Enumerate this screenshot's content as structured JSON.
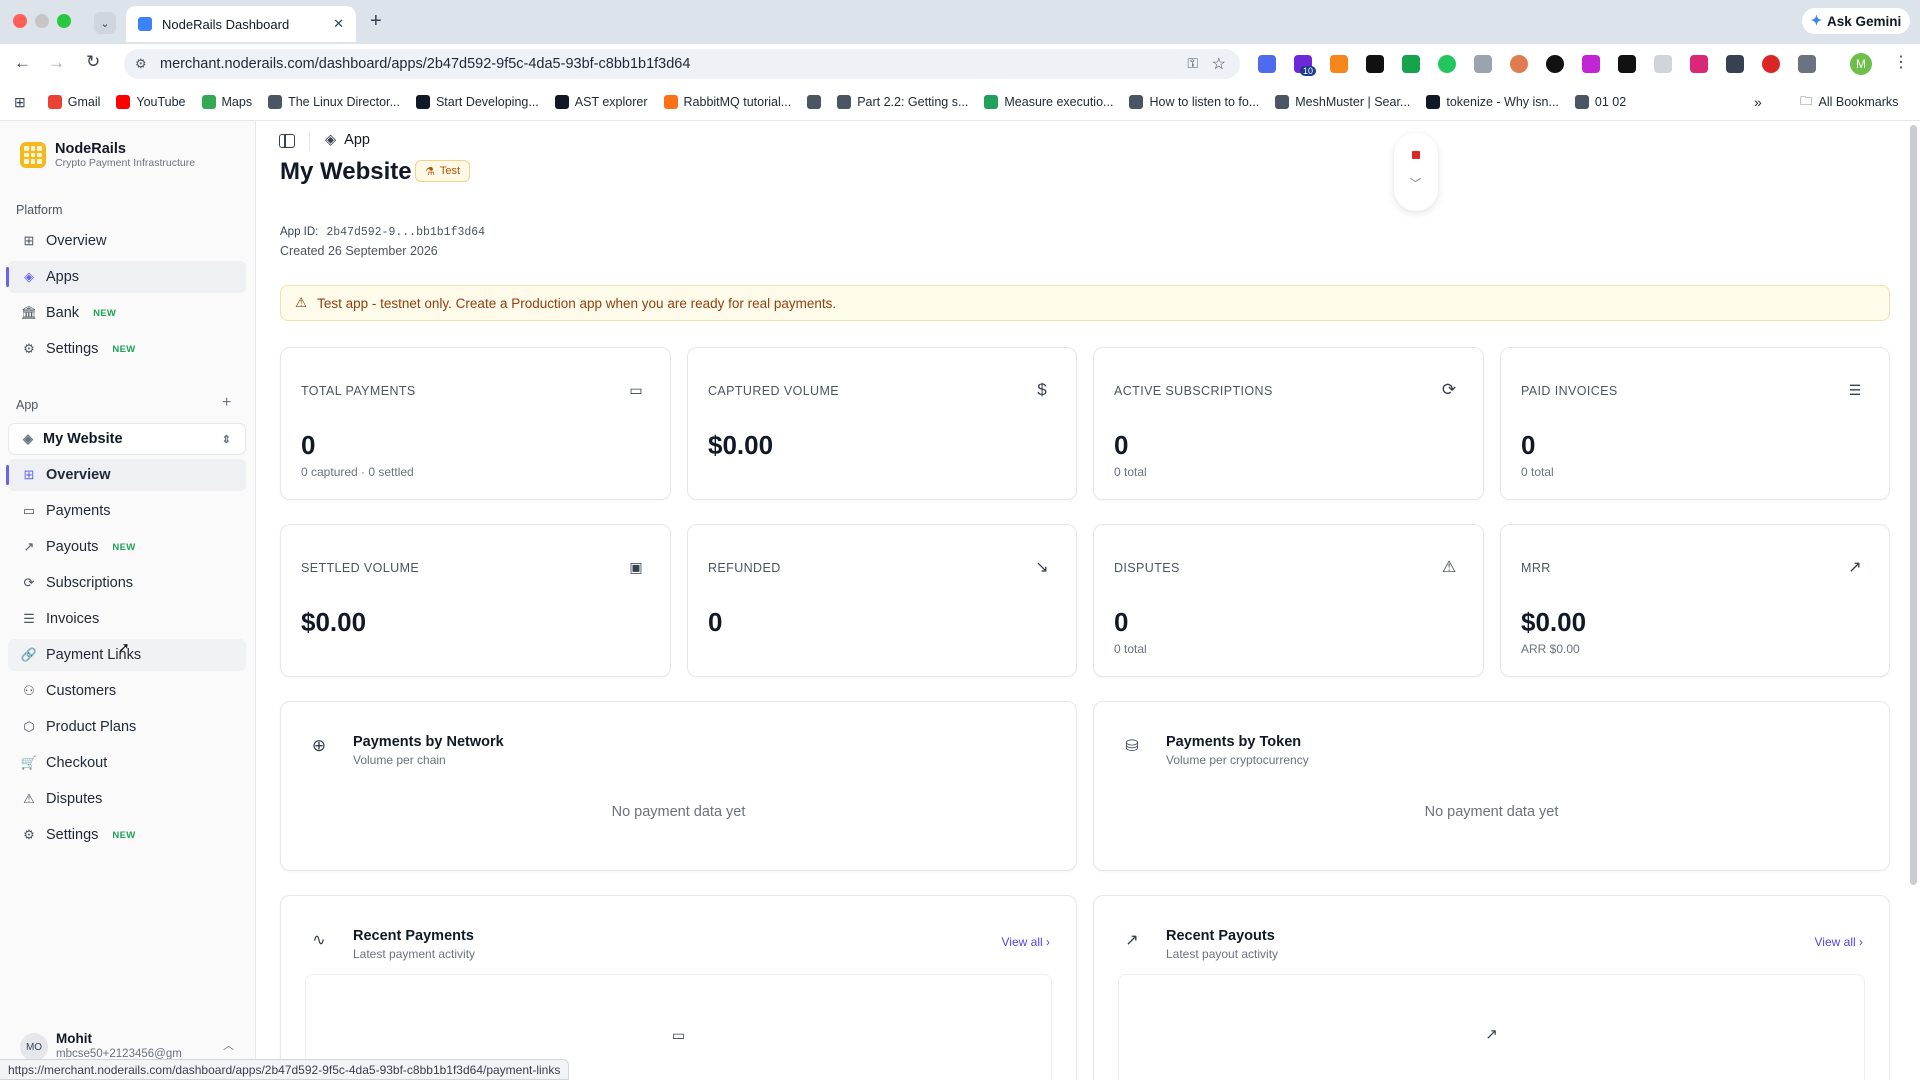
{
  "browser": {
    "tab_title": "NodeRails Dashboard",
    "url": "merchant.noderails.com/dashboard/apps/2b47d592-9f5c-4da5-93bf-c8bb1b1f3d64",
    "ask_gemini": "Ask Gemini",
    "extension_badge": "10",
    "profile_initial": "M",
    "bookmarks": [
      {
        "label": "Gmail",
        "color": "#ea4335"
      },
      {
        "label": "YouTube",
        "color": "#ff0000"
      },
      {
        "label": "Maps",
        "color": "#34a853"
      },
      {
        "label": "The Linux Director...",
        "color": "#4b5563"
      },
      {
        "label": "Start Developing...",
        "color": "#111827"
      },
      {
        "label": "AST explorer",
        "color": "#111827"
      },
      {
        "label": "RabbitMQ tutorial...",
        "color": "#f97316"
      },
      {
        "label": "",
        "color": "#4b5563"
      },
      {
        "label": "Part 2.2: Getting s...",
        "color": "#4b5563"
      },
      {
        "label": "Measure executio...",
        "color": "#22a05a"
      },
      {
        "label": "How to listen to fo...",
        "color": "#4b5563"
      },
      {
        "label": "MeshMuster | Sear...",
        "color": "#4b5563"
      },
      {
        "label": "tokenize - Why isn...",
        "color": "#111827"
      },
      {
        "label": "01 02",
        "color": "#4b5563"
      }
    ],
    "all_bookmarks": "All Bookmarks",
    "status_url": "https://merchant.noderails.com/dashboard/apps/2b47d592-9f5c-4da5-93bf-c8bb1b1f3d64/payment-links"
  },
  "sidebar": {
    "brand": "NodeRails",
    "tagline": "Crypto Payment Infrastructure",
    "platform_label": "Platform",
    "platform_items": [
      {
        "label": "Overview",
        "badge": ""
      },
      {
        "label": "Apps",
        "badge": ""
      },
      {
        "label": "Bank",
        "badge": "NEW"
      },
      {
        "label": "Settings",
        "badge": "NEW"
      }
    ],
    "app_label": "App",
    "app_selector": "My Website",
    "app_items": [
      {
        "label": "Overview",
        "badge": ""
      },
      {
        "label": "Payments",
        "badge": ""
      },
      {
        "label": "Payouts",
        "badge": "NEW"
      },
      {
        "label": "Subscriptions",
        "badge": ""
      },
      {
        "label": "Invoices",
        "badge": ""
      },
      {
        "label": "Payment Links",
        "badge": ""
      },
      {
        "label": "Customers",
        "badge": ""
      },
      {
        "label": "Product Plans",
        "badge": ""
      },
      {
        "label": "Checkout",
        "badge": ""
      },
      {
        "label": "Disputes",
        "badge": ""
      },
      {
        "label": "Settings",
        "badge": "NEW"
      }
    ],
    "user": {
      "initials": "MO",
      "name": "Mohit",
      "email": "mbcse50+2123456@gm"
    }
  },
  "header": {
    "breadcrumb": "App"
  },
  "app": {
    "title": "My Website",
    "badge": "Test",
    "app_id_label": "App ID:",
    "app_id": "2b47d592-9...bb1b1f3d64",
    "created": "Created 26 September 2026",
    "warning": "Test app - testnet only. Create a Production app when you are ready for real payments."
  },
  "stats": [
    {
      "label": "TOTAL PAYMENTS",
      "value": "0",
      "sub": "0 captured · 0 settled",
      "icon": "card-icon"
    },
    {
      "label": "CAPTURED VOLUME",
      "value": "$0.00",
      "sub": "",
      "icon": "dollar-icon"
    },
    {
      "label": "ACTIVE SUBSCRIPTIONS",
      "value": "0",
      "sub": "0 total",
      "icon": "refresh-icon"
    },
    {
      "label": "PAID INVOICES",
      "value": "0",
      "sub": "0 total",
      "icon": "receipt-icon"
    },
    {
      "label": "SETTLED VOLUME",
      "value": "$0.00",
      "sub": "",
      "icon": "banknote-icon"
    },
    {
      "label": "REFUNDED",
      "value": "0",
      "sub": "",
      "icon": "arrow-down-right-icon"
    },
    {
      "label": "DISPUTES",
      "value": "0",
      "sub": "0 total",
      "icon": "warning-icon"
    },
    {
      "label": "MRR",
      "value": "$0.00",
      "sub": "ARR $0.00",
      "icon": "trending-up-icon"
    }
  ],
  "panels": {
    "network": {
      "title": "Payments by Network",
      "sub": "Volume per chain",
      "empty": "No payment data yet"
    },
    "token": {
      "title": "Payments by Token",
      "sub": "Volume per cryptocurrency",
      "empty": "No payment data yet"
    },
    "recent_payments": {
      "title": "Recent Payments",
      "sub": "Latest payment activity",
      "view_all": "View all"
    },
    "recent_payouts": {
      "title": "Recent Payouts",
      "sub": "Latest payout activity",
      "view_all": "View all"
    }
  }
}
